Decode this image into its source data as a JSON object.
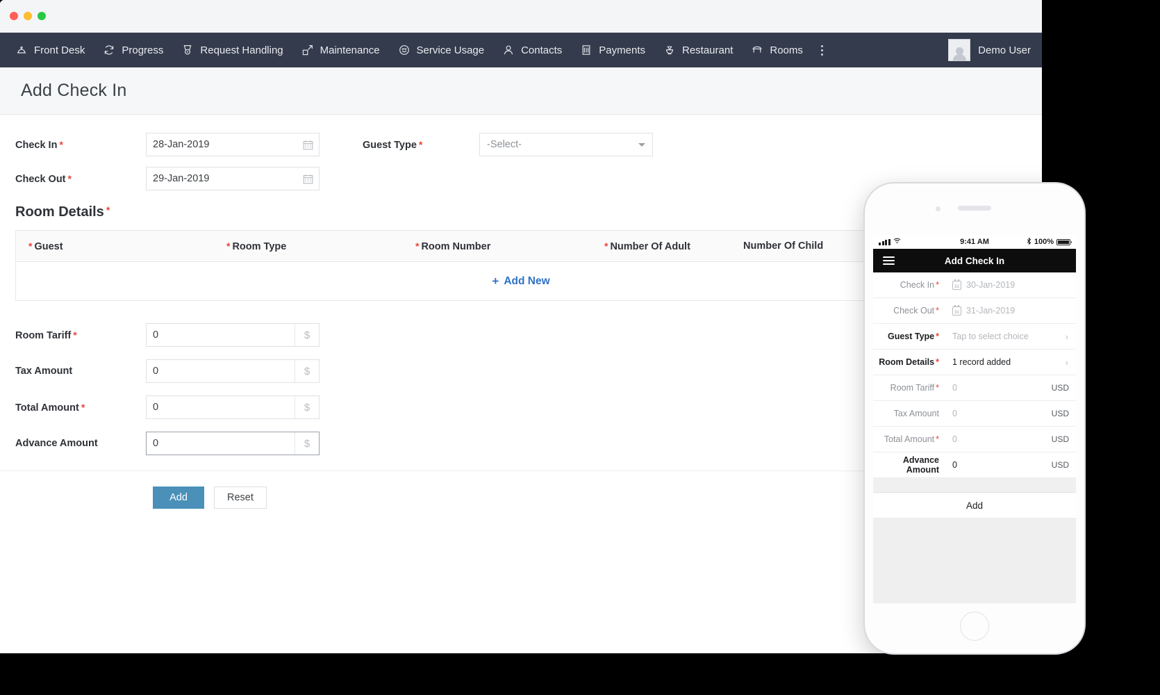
{
  "window": {
    "traffic_lights": [
      "close",
      "minimize",
      "maximize"
    ]
  },
  "nav": {
    "items": [
      {
        "label": "Front Desk",
        "icon": "bell-desk-icon"
      },
      {
        "label": "Progress",
        "icon": "refresh-icon"
      },
      {
        "label": "Request Handling",
        "icon": "medal-icon"
      },
      {
        "label": "Maintenance",
        "icon": "expand-arrow-icon"
      },
      {
        "label": "Service Usage",
        "icon": "room-service-icon"
      },
      {
        "label": "Contacts",
        "icon": "person-icon"
      },
      {
        "label": "Payments",
        "icon": "bill-icon"
      },
      {
        "label": "Restaurant",
        "icon": "teapot-icon"
      },
      {
        "label": "Rooms",
        "icon": "bed-icon"
      }
    ],
    "more_icon": "kebab-menu-icon",
    "user": {
      "name": "Demo User",
      "avatar_icon": "user-avatar-icon"
    }
  },
  "page": {
    "title": "Add Check In"
  },
  "form": {
    "check_in": {
      "label": "Check In",
      "required": true,
      "value": "28-Jan-2019",
      "icon": "calendar-icon"
    },
    "check_out": {
      "label": "Check Out",
      "required": true,
      "value": "29-Jan-2019",
      "icon": "calendar-icon"
    },
    "guest_type": {
      "label": "Guest Type",
      "required": true,
      "value": "-Select-",
      "icon": "chevron-down-icon"
    },
    "room_details": {
      "label": "Room Details",
      "required": true,
      "columns": [
        {
          "label": "Guest",
          "required": true
        },
        {
          "label": "Room Type",
          "required": true
        },
        {
          "label": "Room Number",
          "required": true
        },
        {
          "label": "Number Of Adult",
          "required": true
        },
        {
          "label": "Number Of Child",
          "required": false
        }
      ],
      "add_new_label": "Add New",
      "add_new_icon": "plus-icon"
    },
    "amounts": [
      {
        "label": "Room Tariff",
        "required": true,
        "value": "0",
        "unit": "$"
      },
      {
        "label": "Tax Amount",
        "required": false,
        "value": "0",
        "unit": "$"
      },
      {
        "label": "Total Amount",
        "required": true,
        "value": "0",
        "unit": "$"
      },
      {
        "label": "Advance Amount",
        "required": false,
        "value": "0",
        "unit": "$"
      }
    ],
    "buttons": {
      "submit": "Add",
      "reset": "Reset"
    }
  },
  "phone": {
    "status": {
      "time": "9:41 AM",
      "battery": "100%",
      "bluetooth_icon": "bluetooth-icon",
      "signal_icon": "signal-bars-icon",
      "wifi_icon": "wifi-icon"
    },
    "nav": {
      "title": "Add Check In",
      "menu_icon": "hamburger-icon"
    },
    "rows": [
      {
        "label": "Check In",
        "required": true,
        "value": "30-Jan-2019",
        "unit": "",
        "icon": "calendar-icon",
        "muted_label": true,
        "muted_value": true,
        "chevron": false
      },
      {
        "label": "Check Out",
        "required": true,
        "value": "31-Jan-2019",
        "unit": "",
        "icon": "calendar-icon",
        "muted_label": true,
        "muted_value": true,
        "chevron": false
      },
      {
        "label": "Guest Type",
        "required": true,
        "value": "Tap to select choice",
        "unit": "",
        "icon": "",
        "muted_label": false,
        "muted_value": true,
        "chevron": true
      },
      {
        "label": "Room Details",
        "required": true,
        "value": "1 record added",
        "unit": "",
        "icon": "",
        "muted_label": false,
        "muted_value": false,
        "chevron": true
      },
      {
        "label": "Room Tariff",
        "required": true,
        "value": "0",
        "unit": "USD",
        "icon": "",
        "muted_label": true,
        "muted_value": true,
        "chevron": false
      },
      {
        "label": "Tax Amount",
        "required": false,
        "value": "0",
        "unit": "USD",
        "icon": "",
        "muted_label": true,
        "muted_value": true,
        "chevron": false
      },
      {
        "label": "Total Amount",
        "required": true,
        "value": "0",
        "unit": "USD",
        "icon": "",
        "muted_label": true,
        "muted_value": true,
        "chevron": false
      },
      {
        "label": "Advance Amount",
        "required": false,
        "value": "0",
        "unit": "USD",
        "icon": "",
        "muted_label": false,
        "muted_value": false,
        "chevron": false
      }
    ],
    "add_button": "Add"
  },
  "colors": {
    "navbar": "#343b4c",
    "accent_blue": "#2f72c4",
    "primary_button": "#4a90b9",
    "required_red": "#e8453c",
    "phone_nav": "#0d0d0d"
  }
}
